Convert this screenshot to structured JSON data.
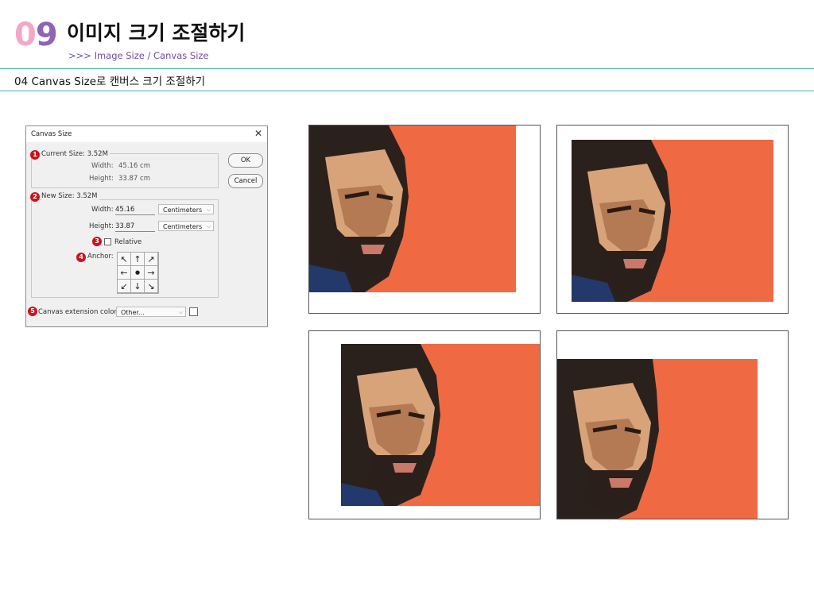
{
  "header": {
    "chapter_number_0": "0",
    "chapter_number_9": "9",
    "chapter_title": "이미지 크기 조절하기",
    "chapter_subtitle": ">>> Image Size / Canvas Size",
    "section_title": "04 Canvas Size로 캔버스 크기 조절하기"
  },
  "dialog": {
    "title": "Canvas Size",
    "close_glyph": "✕",
    "ok_label": "OK",
    "cancel_label": "Cancel",
    "current_size": {
      "label": "Current Size: 3.52M",
      "width_label": "Width:",
      "width_value": "45.16 cm",
      "height_label": "Height:",
      "height_value": "33.87 cm"
    },
    "new_size": {
      "label": "New Size: 3.52M",
      "width_label": "Width:",
      "width_value": "45.16",
      "width_unit": "Centimeters",
      "height_label": "Height:",
      "height_value": "33.87",
      "height_unit": "Centimeters",
      "relative_label": "Relative",
      "relative_checked": false,
      "anchor_label": "Anchor:",
      "anchor_glyphs": [
        "↖",
        "↑",
        "↗",
        "←",
        "●",
        "→",
        "↙",
        "↓",
        "↘"
      ]
    },
    "extension": {
      "label": "Canvas extension color:",
      "value": "Other...",
      "swatch_color": "#ffffff"
    },
    "badges": [
      "1",
      "2",
      "3",
      "4",
      "5"
    ],
    "badge_color": "#c9141b"
  },
  "examples": {
    "count": 4,
    "background_color": "#ef6a43",
    "canvas_color": "#ffffff",
    "icons": [
      "portrait-image"
    ]
  },
  "colors": {
    "accent_rule": "#3cb7ae",
    "subtitle": "#6a4da6",
    "number_pink": "#f3a6c8",
    "number_purple": "#8f63b8"
  }
}
